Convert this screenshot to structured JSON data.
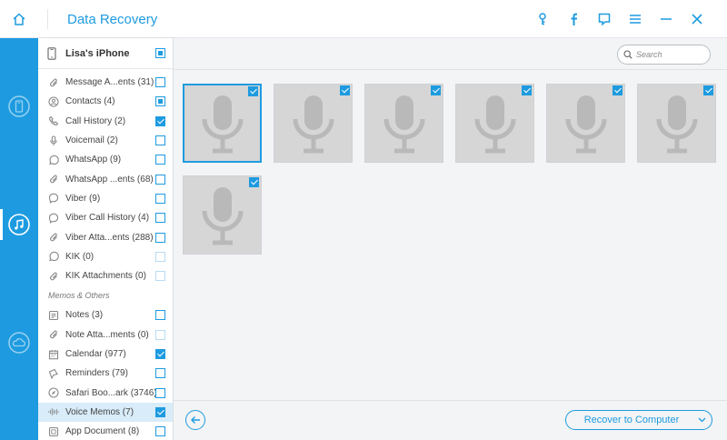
{
  "app": {
    "title": "Data Recovery"
  },
  "colors": {
    "accent": "#1e9be0",
    "rail": "#1e9be0",
    "thumb_bg": "#d6d6d6"
  },
  "titlebar_icons": [
    "key-icon",
    "facebook-icon",
    "feedback-icon",
    "menu-icon",
    "minimize-icon",
    "close-icon"
  ],
  "rail": [
    "phone-restore-icon",
    "music-restore-icon",
    "cloud-restore-icon"
  ],
  "device": {
    "name": "Lisa's iPhone",
    "checked": "partial"
  },
  "categories": [
    {
      "label": "Message A...ents (31)",
      "icon": "paperclip-icon",
      "state": "none"
    },
    {
      "label": "Contacts (4)",
      "icon": "contacts-icon",
      "state": "partial"
    },
    {
      "label": "Call History (2)",
      "icon": "phone-icon",
      "state": "checked"
    },
    {
      "label": "Voicemail (2)",
      "icon": "microphone-icon",
      "state": "none"
    },
    {
      "label": "WhatsApp (9)",
      "icon": "whatsapp-icon",
      "state": "none"
    },
    {
      "label": "WhatsApp ...ents (68)",
      "icon": "paperclip-icon",
      "state": "none"
    },
    {
      "label": "Viber (9)",
      "icon": "viber-icon",
      "state": "none"
    },
    {
      "label": "Viber Call History (4)",
      "icon": "viber-icon",
      "state": "none"
    },
    {
      "label": "Viber Atta...ents (288)",
      "icon": "paperclip-icon",
      "state": "none"
    },
    {
      "label": "KIK (0)",
      "icon": "kik-icon",
      "state": "disabled"
    },
    {
      "label": "KIK Attachments (0)",
      "icon": "paperclip-icon",
      "state": "disabled"
    }
  ],
  "memos_section": {
    "label": "Memos & Others"
  },
  "memos": [
    {
      "label": "Notes (3)",
      "icon": "notes-icon",
      "state": "none"
    },
    {
      "label": "Note Atta...ments (0)",
      "icon": "paperclip-icon",
      "state": "disabled"
    },
    {
      "label": "Calendar (977)",
      "icon": "calendar-icon",
      "state": "checked"
    },
    {
      "label": "Reminders (79)",
      "icon": "reminders-icon",
      "state": "none"
    },
    {
      "label": "Safari Boo...ark (3746)",
      "icon": "compass-icon",
      "state": "none"
    },
    {
      "label": "Voice Memos (7)",
      "icon": "waveform-icon",
      "state": "checked",
      "selected": true
    },
    {
      "label": "App Document (8)",
      "icon": "document-icon",
      "state": "none"
    }
  ],
  "search": {
    "placeholder": "Search"
  },
  "voice_memos": [
    {
      "checked": true,
      "selected": true
    },
    {
      "checked": true
    },
    {
      "checked": true
    },
    {
      "checked": true
    },
    {
      "checked": true
    },
    {
      "checked": true
    },
    {
      "checked": true
    }
  ],
  "actions": {
    "recover_label": "Recover to Computer"
  }
}
